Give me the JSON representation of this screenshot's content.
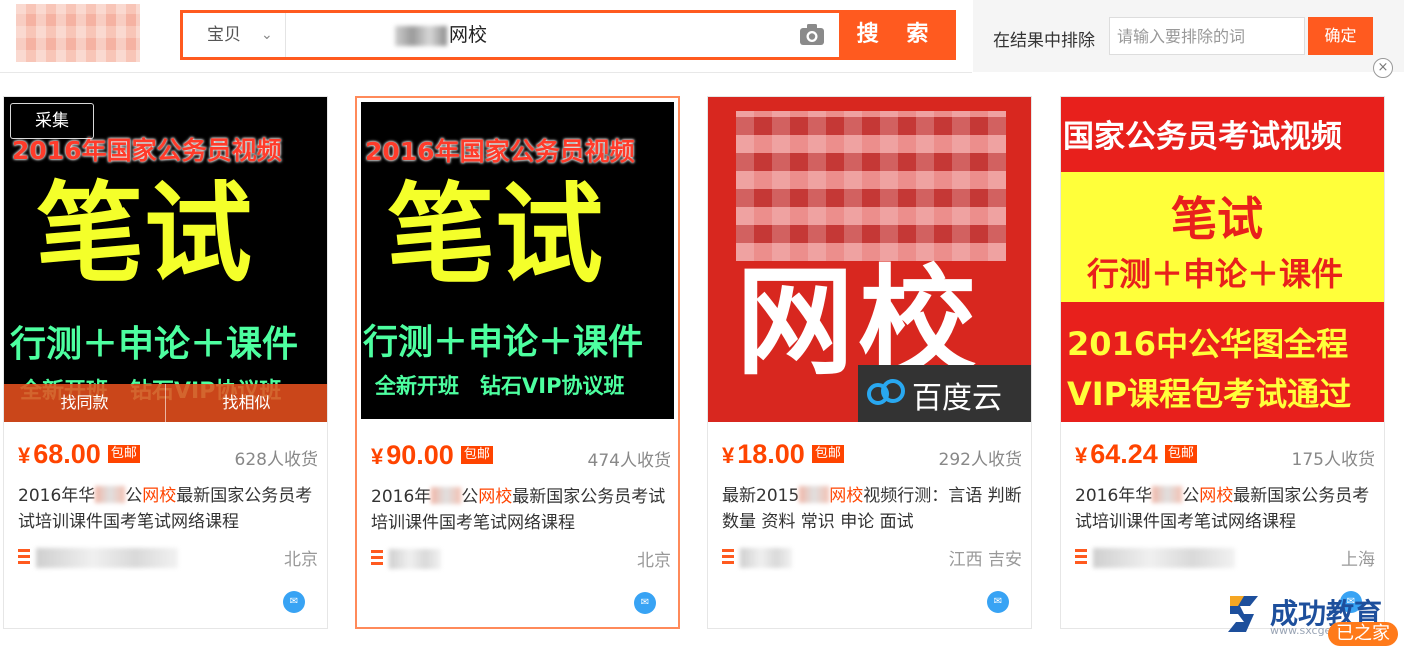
{
  "header": {
    "search_type": "宝贝",
    "search_query": "网校",
    "search_button": "搜 索",
    "filter_label": "在结果中排除",
    "exclude_placeholder": "请输入要排除的词",
    "confirm_button": "确定",
    "close_symbol": "×"
  },
  "products": [
    {
      "price": "68.00",
      "currency": "¥",
      "free_shipping": "包邮",
      "sales": "628人收货",
      "title_prefix": "2016年华",
      "title_mid": "公",
      "title_highlight": "网校",
      "title_suffix": "最新国家公务员考试培训课件国考笔试网络课程",
      "location": "北京",
      "collect_tag": "采集",
      "find_same": "找同款",
      "find_similar": "找相似",
      "image": {
        "banner": "2016年国家公务员视频",
        "big": "笔试",
        "mid": "行测＋申论＋课件",
        "bottom": "全新开班　钻石VIP协议班"
      }
    },
    {
      "price": "90.00",
      "currency": "¥",
      "free_shipping": "包邮",
      "sales": "474人收货",
      "title_prefix": "2016年",
      "title_mid": "公",
      "title_highlight": "网校",
      "title_suffix": "最新国家公务员考试培训课件国考笔试网络课程",
      "location": "北京",
      "image": {
        "banner": "2016年国家公务员视频",
        "big": "笔试",
        "mid": "行测＋申论＋课件",
        "bottom": "全新开班　钻石VIP协议班"
      }
    },
    {
      "price": "18.00",
      "currency": "¥",
      "free_shipping": "包邮",
      "sales": "292人收货",
      "title_prefix": "最新2015",
      "title_highlight": "网校",
      "title_suffix": "视频行测：言语 判断 数量 资料 常识 申论 面试",
      "location": "江西 吉安",
      "image": {
        "big": "网校",
        "brand": "百度云"
      }
    },
    {
      "price": "64.24",
      "currency": "¥",
      "free_shipping": "包邮",
      "sales": "175人收货",
      "title_prefix": "2016年华",
      "title_mid": "公",
      "title_highlight": "网校",
      "title_suffix": "最新国家公务员考试培训课件国考笔试网络课程",
      "location": "上海",
      "image": {
        "top": "国家公务员考试视频",
        "big": "笔试",
        "mid": "行测＋申论＋课件",
        "line1": "2016中公华图全程",
        "line2": "VIP课程包考试通过"
      }
    }
  ],
  "watermark": {
    "name": "成功教育",
    "url": "www.sxcgedu.com",
    "sub": "已之家"
  },
  "colors": {
    "accent": "#ff5a1f",
    "price": "#ff4400",
    "chat": "#38a3f4"
  }
}
